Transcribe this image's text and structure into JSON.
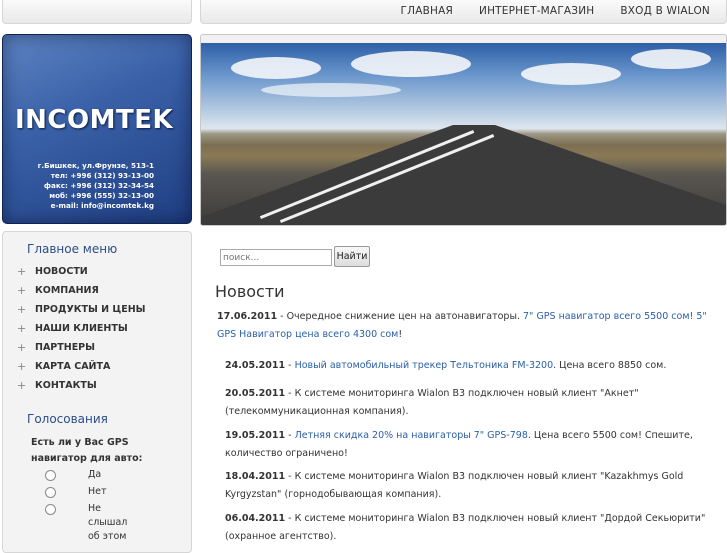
{
  "topnav": {
    "items": [
      "ГЛАВНАЯ",
      "ИНТЕРНЕТ-МАГАЗИН",
      "ВХОД В WIALON"
    ]
  },
  "logo": {
    "brand": "INCOMTEK",
    "address": "г.Бишкек, ул.Фрунзе, 513-1",
    "tel": "тел: +996 (312) 93-13-00",
    "fax": "факс: +996 (312) 32-34-54",
    "mob": "моб: +996 (555) 32-13-00",
    "email": "e-mail: info@incomtek.kg"
  },
  "sidebar": {
    "menu_title": "Главное меню",
    "menu_items": [
      "НОВОСТИ",
      "КОМПАНИЯ",
      "ПРОДУКТЫ И ЦЕНЫ",
      "НАШИ КЛИЕНТЫ",
      "ПАРТНЕРЫ",
      "КАРТА САЙТА",
      "КОНТАКТЫ"
    ],
    "poll_title": "Голосования",
    "poll_question": "Есть ли у Вас GPS навигатор для авто:",
    "poll_options": [
      "Да",
      "Нет",
      "Не слышал об этом"
    ]
  },
  "search": {
    "placeholder": "поиск...",
    "button": "Найти"
  },
  "news": {
    "title": "Новости",
    "items": [
      {
        "date": "17.06.2011",
        "before": " - Очередное снижение цен на автонавигаторы. ",
        "link": "7\" GPS навигатор всего 5500 сом! 5\" GPS Навигатор цена всего 4300 сом",
        "after": "!"
      },
      {
        "date": "24.05.2011",
        "before": " - ",
        "link": "Новый автомобильный трекер Тельтоника FM-3200",
        "after": ". Цена всего 8850 сом."
      },
      {
        "date": "20.05.2011",
        "before": " - К системе мониторинга Wialon B3 подключен новый клиент \"Акнет\" (телекоммуникационная компания).",
        "link": "",
        "after": ""
      },
      {
        "date": "19.05.2011",
        "before": " - ",
        "link": "Летняя скидка 20% на навигаторы 7\" GPS-798",
        "after": ". Цена всего 5500 сом! Спешите, количество ограничено!"
      },
      {
        "date": "18.04.2011",
        "before": " - К системе мониторинга Wialon B3 подключен новый клиент \"Kazakhmys Gold Kyrgyzstan\" (горнодобывающая компания).",
        "link": "",
        "after": ""
      },
      {
        "date": "06.04.2011",
        "before": " - К системе мониторинга Wialon B3 подключен новый клиент \"Дордой Секьюрити\" (охранное агентство).",
        "link": "",
        "after": ""
      }
    ]
  }
}
